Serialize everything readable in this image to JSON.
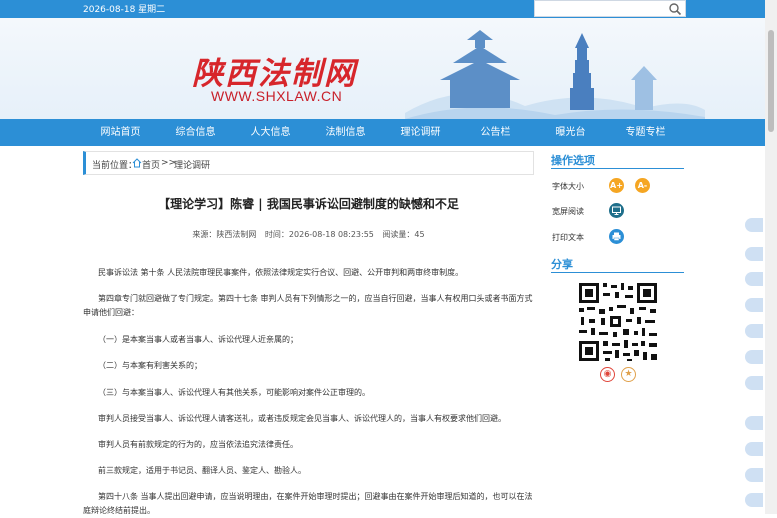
{
  "topbar": {
    "date": "2026-08-18 星期二"
  },
  "search": {
    "placeholder": ""
  },
  "logo": {
    "cn": "陕西法制网",
    "url": "WWW.SHXLAW.CN"
  },
  "nav": [
    "网站首页",
    "综合信息",
    "人大信息",
    "法制信息",
    "理论调研",
    "公告栏",
    "曝光台",
    "专题专栏"
  ],
  "breadcrumb": {
    "prefix": "当前位置：",
    "home": "首页",
    "sep": ">>",
    "current": "理论调研"
  },
  "article": {
    "title": "【理论学习】陈睿 | 我国民事诉讼回避制度的缺憾和不足",
    "source": "来源：陕西法制网",
    "time": "时间：2026-08-18 08:23:55",
    "views": "阅读量：45",
    "paragraphs": [
      "民事诉讼法 第十条 人民法院审理民事案件，依照法律规定实行合议、回避、公开审判和两审终审制度。",
      "第四章专门就回避做了专门规定。第四十七条 审判人员有下列情形之一的，应当自行回避，当事人有权用口头或者书面方式申请他们回避：",
      "（一）是本案当事人或者当事人、诉讼代理人近亲属的；",
      "（二）与本案有利害关系的；",
      "（三）与本案当事人、诉讼代理人有其他关系，可能影响对案件公正审理的。",
      "审判人员接受当事人、诉讼代理人请客送礼，或者违反规定会见当事人、诉讼代理人的，当事人有权要求他们回避。",
      "审判人员有前款规定的行为的，应当依法追究法律责任。",
      "前三款规定，适用于书记员、翻译人员、鉴定人、勘验人。",
      "第四十八条 当事人提出回避申请，应当说明理由，在案件开始审理时提出；回避事由在案件开始审理后知道的，也可以在法庭辩论终结前提出。"
    ]
  },
  "sidebar": {
    "tools_title": "操作选项",
    "font_size": "字体大小",
    "font_up": "A+",
    "font_down": "A-",
    "wide_read": "宽屏阅读",
    "print": "打印文本",
    "share_title": "分享"
  },
  "colors": {
    "accent": "#2c8fd6",
    "logo_red": "#d7262b",
    "orange": "#f5a623",
    "teal": "#1f6f8b"
  }
}
